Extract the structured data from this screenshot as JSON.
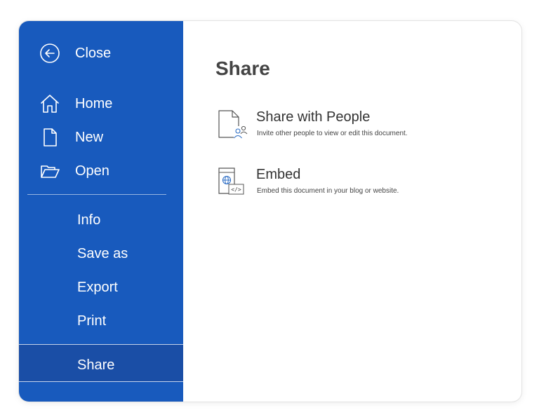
{
  "sidebar": {
    "close_label": "Close",
    "items": [
      {
        "label": "Home",
        "icon": "home-icon"
      },
      {
        "label": "New",
        "icon": "new-document-icon"
      },
      {
        "label": "Open",
        "icon": "folder-open-icon"
      }
    ],
    "sub_items": [
      {
        "label": "Info"
      },
      {
        "label": "Save as"
      },
      {
        "label": "Export"
      },
      {
        "label": "Print"
      },
      {
        "label": "Share"
      }
    ],
    "active_item": "Share"
  },
  "main": {
    "title": "Share",
    "options": [
      {
        "title": "Share with People",
        "description": "Invite other people to view or edit this document.",
        "icon": "share-people-icon"
      },
      {
        "title": "Embed",
        "description": "Embed this document in your blog or website.",
        "icon": "embed-code-icon"
      }
    ]
  },
  "colors": {
    "sidebar_bg": "#185abd",
    "sidebar_active_bg": "#1a4ea6",
    "text_dark": "#333333"
  }
}
